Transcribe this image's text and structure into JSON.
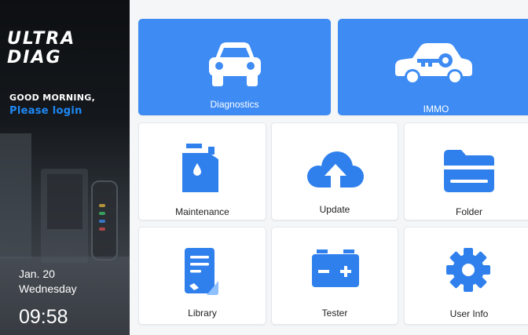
{
  "sidebar": {
    "logo_line1": "ULTRA",
    "logo_line2": "DIAG",
    "greeting": "GOOD MORNING,",
    "login_link": "Please login",
    "date": "Jan. 20",
    "weekday": "Wednesday",
    "time": "09:58"
  },
  "tiles": {
    "diagnostics": "Diagnostics",
    "immo": "IMMO",
    "maintenance": "Maintenance",
    "update": "Update",
    "folder": "Folder",
    "library": "Library",
    "tester": "Tester",
    "user_info": "User Info"
  },
  "colors": {
    "accent": "#3d8bf3",
    "icon_blue": "#2f80ed",
    "login_blue": "#1e88f5"
  },
  "icons": {
    "diagnostics": "car-front-icon",
    "immo": "car-key-icon",
    "maintenance": "oil-can-icon",
    "update": "cloud-upload-icon",
    "folder": "folder-icon",
    "library": "document-icon",
    "tester": "battery-icon",
    "user_info": "gear-icon"
  }
}
